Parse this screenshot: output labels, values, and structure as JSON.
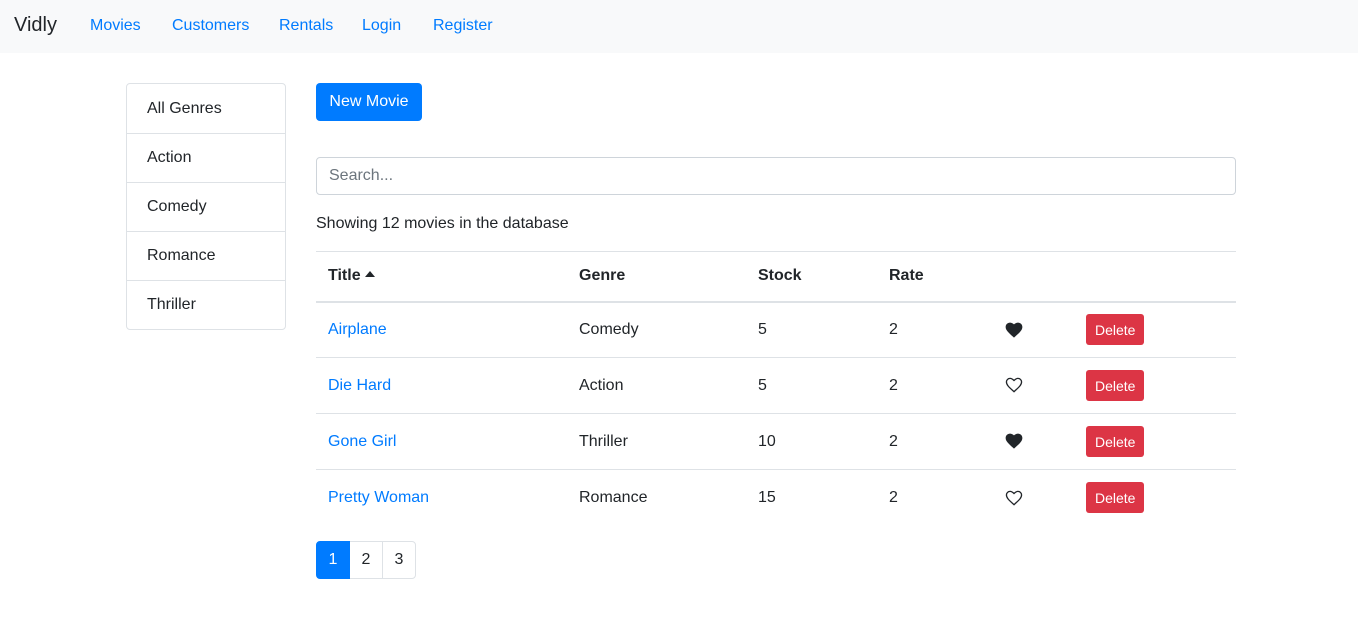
{
  "navbar": {
    "brand": "Vidly",
    "links": [
      "Movies",
      "Customers",
      "Rentals",
      "Login",
      "Register"
    ]
  },
  "genres": [
    "All Genres",
    "Action",
    "Comedy",
    "Romance",
    "Thriller"
  ],
  "actions": {
    "new_movie_label": "New Movie"
  },
  "search": {
    "placeholder": "Search...",
    "value": ""
  },
  "summary": "Showing 12 movies in the database",
  "table": {
    "headers": [
      "Title",
      "Genre",
      "Stock",
      "Rate"
    ],
    "sort": {
      "column": "Title",
      "order": "asc"
    },
    "rows": [
      {
        "title": "Airplane",
        "genre": "Comedy",
        "stock": "5",
        "rate": "2",
        "liked": true,
        "delete_label": "Delete"
      },
      {
        "title": "Die Hard",
        "genre": "Action",
        "stock": "5",
        "rate": "2",
        "liked": false,
        "delete_label": "Delete"
      },
      {
        "title": "Gone Girl",
        "genre": "Thriller",
        "stock": "10",
        "rate": "2",
        "liked": true,
        "delete_label": "Delete"
      },
      {
        "title": "Pretty Woman",
        "genre": "Romance",
        "stock": "15",
        "rate": "2",
        "liked": false,
        "delete_label": "Delete"
      }
    ]
  },
  "pagination": {
    "pages": [
      "1",
      "2",
      "3"
    ],
    "current": "1"
  },
  "colors": {
    "primary": "#007bff",
    "danger": "#dc3545",
    "navbar_bg": "#f8f9fa",
    "text": "#212529"
  }
}
